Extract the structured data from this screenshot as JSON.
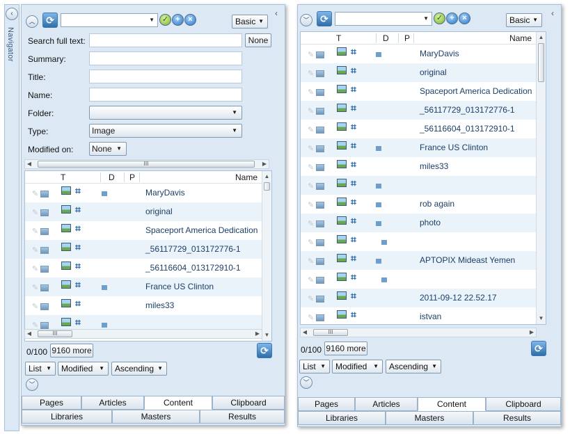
{
  "navigator": {
    "label": "Navigator"
  },
  "left_panel": {
    "mode_label": "Basic",
    "combo_value": "",
    "filters": {
      "search_full_text": {
        "label": "Search full text:",
        "value": "",
        "none_label": "None"
      },
      "summary": {
        "label": "Summary:",
        "value": ""
      },
      "title": {
        "label": "Title:",
        "value": ""
      },
      "name": {
        "label": "Name:",
        "value": ""
      },
      "folder": {
        "label": "Folder:",
        "value": ""
      },
      "type": {
        "label": "Type:",
        "value": "Image"
      },
      "modified_on": {
        "label": "Modified on:",
        "value": "None"
      }
    },
    "columns": {
      "t": "T",
      "d": "D",
      "p": "P",
      "name": "Name"
    },
    "rows": [
      {
        "name": "MaryDavis",
        "d": true
      },
      {
        "name": "original",
        "d": false
      },
      {
        "name": "Spaceport America Dedication",
        "d": false
      },
      {
        "name": "_56117729_013172776-1",
        "d": false
      },
      {
        "name": "_56116604_013172910-1",
        "d": false
      },
      {
        "name": "France US Clinton",
        "d": true
      },
      {
        "name": "miles33",
        "d": false
      },
      {
        "name": "",
        "d": true
      }
    ],
    "count": "0/100",
    "more_label": "9160 more",
    "view_label": "List",
    "sort_label": "Modified",
    "order_label": "Ascending"
  },
  "right_panel": {
    "mode_label": "Basic",
    "combo_value": "",
    "columns": {
      "t": "T",
      "d": "D",
      "p": "P",
      "name": "Name"
    },
    "rows": [
      {
        "name": "MaryDavis",
        "d": true
      },
      {
        "name": "original",
        "d": false
      },
      {
        "name": "Spaceport America Dedication",
        "d": false
      },
      {
        "name": "_56117729_013172776-1",
        "d": false
      },
      {
        "name": "_56116604_013172910-1",
        "d": false
      },
      {
        "name": "France US Clinton",
        "d": true
      },
      {
        "name": "miles33",
        "d": false
      },
      {
        "name": "",
        "d": true
      },
      {
        "name": "rob again",
        "d": true
      },
      {
        "name": "photo",
        "d": true
      },
      {
        "name": "",
        "d": true,
        "indent": true
      },
      {
        "name": "APTOPIX Mideast Yemen",
        "d": true
      },
      {
        "name": "",
        "d": true,
        "indent": true
      },
      {
        "name": "2011-09-12 22.52.17",
        "d": false
      },
      {
        "name": "istvan",
        "d": false
      }
    ],
    "count": "0/100",
    "more_label": "9160 more",
    "view_label": "List",
    "sort_label": "Modified",
    "order_label": "Ascending"
  },
  "tabs": {
    "row1": [
      "Pages",
      "Articles",
      "Content",
      "Clipboard"
    ],
    "row2": [
      "Libraries",
      "Masters",
      "Results"
    ],
    "active": "Content"
  },
  "icons": {
    "collapse_up": "chevron-up-circle-icon",
    "collapse_down": "chevron-down-circle-icon",
    "refresh": "refresh-icon",
    "apply": "check-icon",
    "add": "plus-icon",
    "clear": "x-icon"
  }
}
